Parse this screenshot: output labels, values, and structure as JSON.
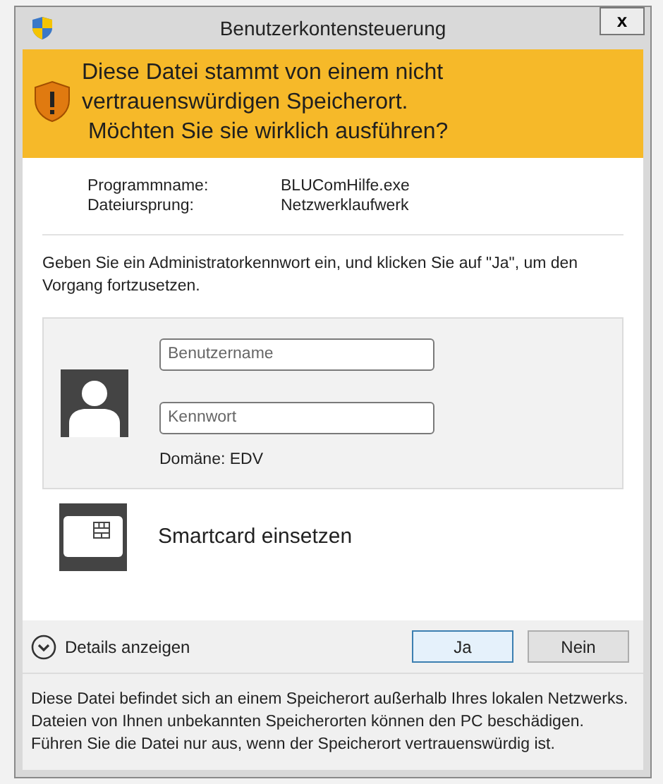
{
  "window": {
    "title": "Benutzerkontensteuerung",
    "close": "x"
  },
  "banner": {
    "lines": [
      "Diese Datei stammt von einem nicht",
      "vertrauenswürdigen Speicherort.",
      " Möchten Sie sie wirklich ausführen?"
    ]
  },
  "info": [
    {
      "label": "Programmname:",
      "value": "BLUComHilfe.exe"
    },
    {
      "label": "Dateiursprung:",
      "value": "Netzwerklaufwerk"
    }
  ],
  "instruction": "Geben Sie ein Administratorkennwort ein, und klicken Sie auf \"Ja\", um den Vorgang fortzusetzen.",
  "login": {
    "username": {
      "placeholder": "Benutzername"
    },
    "password": {
      "placeholder": "Kennwort"
    },
    "domain": "Domäne: EDV"
  },
  "smartcard": {
    "label": "Smartcard einsetzen"
  },
  "details": {
    "label": "Details anzeigen",
    "expanded": false
  },
  "buttons": [
    {
      "label": "Ja",
      "selected": true
    },
    {
      "label": "Nein",
      "selected": false
    }
  ],
  "notice": "Diese Datei befindet sich an einem Speicherort außerhalb Ihres lokalen Netzwerks. Dateien von Ihnen unbekannten Speicherorten können den PC beschädigen. Führen Sie die Datei nur aus, wenn der Speicherort vertrauenswürdig ist."
}
